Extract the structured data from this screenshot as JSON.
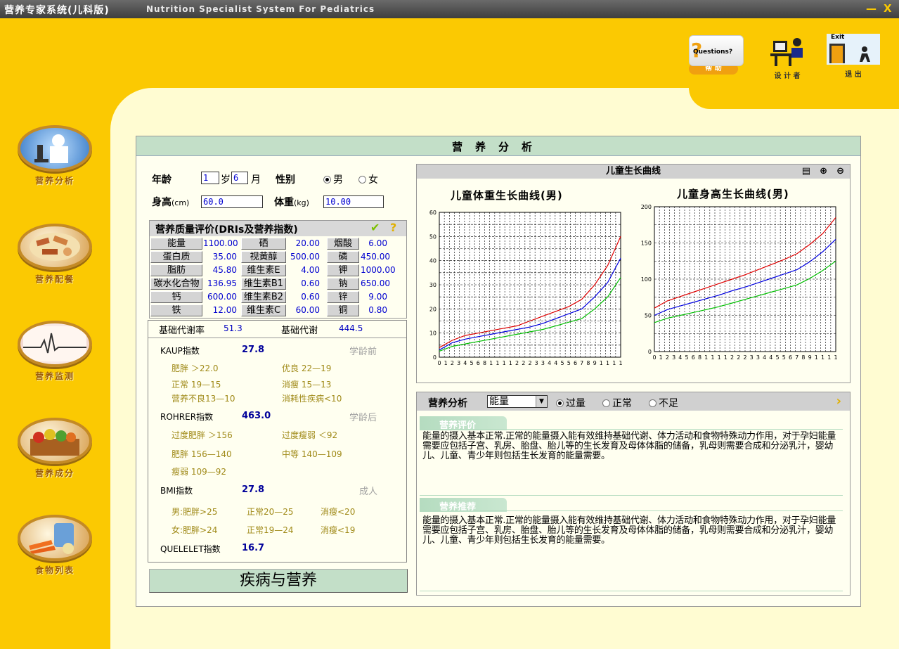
{
  "window": {
    "title": "营养专家系统(儿科版)",
    "subtitle": "Nutrition Specialist System For Pediatrics",
    "minimize": "—",
    "close": "X"
  },
  "toolbar": {
    "help_caption": "Questions?",
    "help_label": "帮 助",
    "designer_label": "设 计 者",
    "exit_caption": "Exit",
    "exit_label": "退 出"
  },
  "sidebar": [
    {
      "label": "营养分析",
      "icon": "doctor-microscope-icon"
    },
    {
      "label": "营养配餐",
      "icon": "meal-plate-icon"
    },
    {
      "label": "营养监测",
      "icon": "ecg-monitor-icon"
    },
    {
      "label": "营养成分",
      "icon": "food-basket-icon"
    },
    {
      "label": "食物列表",
      "icon": "vegetables-icon"
    }
  ],
  "panel": {
    "title": "营养分析"
  },
  "form": {
    "age_label": "年龄",
    "age_years": "1",
    "years_unit": "岁",
    "age_months": "6",
    "months_unit": "月",
    "sex_label": "性别",
    "sex_male": "男",
    "sex_female": "女",
    "height_label": "身高",
    "height_unit": "(cm)",
    "height_value": "60.0",
    "weight_label": "体重",
    "weight_unit": "(kg)",
    "weight_value": "10.00"
  },
  "nutrients": {
    "title": "营养质量评价(DRIs及营养指数)",
    "rows": [
      [
        {
          "name": "能量",
          "value": "1100.00"
        },
        {
          "name": "硒",
          "value": "20.00"
        },
        {
          "name": "烟酸",
          "value": "6.00"
        }
      ],
      [
        {
          "name": "蛋白质",
          "value": "35.00"
        },
        {
          "name": "视黄醇",
          "value": "500.00"
        },
        {
          "name": "磷",
          "value": "450.00"
        }
      ],
      [
        {
          "name": "脂肪",
          "value": "45.80"
        },
        {
          "name": "维生素E",
          "value": "4.00"
        },
        {
          "name": "钾",
          "value": "1000.00"
        }
      ],
      [
        {
          "name": "碳水化合物",
          "value": "136.95"
        },
        {
          "name": "维生素B1",
          "value": "0.60"
        },
        {
          "name": "钠",
          "value": "650.00"
        }
      ],
      [
        {
          "name": "钙",
          "value": "600.00"
        },
        {
          "name": "维生素B2",
          "value": "0.60"
        },
        {
          "name": "锌",
          "value": "9.00"
        }
      ],
      [
        {
          "name": "铁",
          "value": "12.00"
        },
        {
          "name": "维生素C",
          "value": "60.00"
        },
        {
          "name": "铜",
          "value": "0.80"
        }
      ]
    ]
  },
  "metabolism": {
    "bmr_label": "基础代谢率",
    "bmr_value": "51.3",
    "bm_label": "基础代谢",
    "bm_value": "444.5"
  },
  "indices": {
    "kaup_label": "KAUP指数",
    "kaup_value": "27.8",
    "kaup_group": "学龄前",
    "kaup_ranges": [
      "肥胖 ＞22.0",
      "优良 22—19",
      "正常 19—15",
      "消瘦 15—13",
      "营养不良13—10",
      "消耗性疾病<10"
    ],
    "rohrer_label": "ROHRER指数",
    "rohrer_value": "463.0",
    "rohrer_group": "学龄后",
    "rohrer_ranges": [
      "过度肥胖 ＞156",
      "过度瘦弱 ＜92",
      "肥胖 156—140",
      "中等 140—109",
      "瘦弱 109—92"
    ],
    "bmi_label": "BMI指数",
    "bmi_value": "27.8",
    "bmi_group": "成人",
    "bmi_ranges": [
      "男:肥胖>25",
      "正常20—25",
      "消瘦<20",
      "女:肥胖>24",
      "正常19—24",
      "消瘦<19"
    ],
    "quelelet_label": "QUELELET指数",
    "quelelet_value": "16.7"
  },
  "disease_button": "疾病与营养",
  "growth": {
    "header": "儿童生长曲线",
    "weight_title": "儿童体重生长曲线(男)",
    "height_title": "儿童身高生长曲线(男)"
  },
  "analysis": {
    "label": "营养分析",
    "select_value": "能量",
    "opt_over": "过量",
    "opt_normal": "正常",
    "opt_low": "不足",
    "eval_tag": "营养评价",
    "eval_text": "能量的摄入基本正常.正常的能量摄入能有效维持基础代谢、体力活动和食物特殊动力作用，对于孕妇能量需要应包括子宫、乳房、胎盘、胎儿等的生长发育及母体体脂的储备，乳母则需要合成和分泌乳汁，婴幼儿、儿童、青少年则包括生长发育的能量需要。",
    "rec_tag": "营养推荐",
    "rec_text": "能量的摄入基本正常.正常的能量摄入能有效维持基础代谢、体力活动和食物特殊动力作用，对于孕妇能量需要应包括子宫、乳房、胎盘、胎儿等的生长发育及母体体脂的储备，乳母则需要合成和分泌乳汁，婴幼儿、儿童、青少年则包括生长发育的能量需要。"
  },
  "colors": {
    "upper": "#e00000",
    "median": "#0000e0",
    "lower": "#00c000"
  },
  "chart_data": [
    {
      "type": "line",
      "title": "儿童体重生长曲线(男)",
      "ylim": [
        0,
        60
      ],
      "yticks": [
        0,
        10,
        20,
        30,
        40,
        50,
        60
      ],
      "xticks": [
        "0",
        "1",
        "2",
        "3",
        "4",
        "5",
        "6",
        "8",
        "1",
        "1",
        "1",
        "1",
        "2",
        "2",
        "2",
        "3",
        "3",
        "4",
        "4",
        "5",
        "5",
        "6",
        "7",
        "8",
        "9",
        "1",
        "1",
        "1",
        "1"
      ],
      "x": [
        0,
        2,
        4,
        6,
        8,
        10,
        12,
        14,
        16,
        18,
        20,
        22,
        24,
        26,
        28
      ],
      "series": [
        {
          "values": [
            4,
            7,
            9,
            10,
            11,
            12,
            13,
            15,
            17,
            19,
            21,
            24,
            30,
            38,
            50
          ]
        },
        {
          "values": [
            3,
            6,
            7.5,
            8.5,
            9.5,
            10.5,
            11.5,
            12.5,
            14,
            16,
            18,
            20,
            25,
            31,
            41
          ]
        },
        {
          "values": [
            2.5,
            4.5,
            5.5,
            6.5,
            7.5,
            8.5,
            9.5,
            10.5,
            11.5,
            13,
            14.5,
            16,
            20,
            25,
            33
          ]
        }
      ]
    },
    {
      "type": "line",
      "title": "儿童身高生长曲线(男)",
      "ylim": [
        0,
        200
      ],
      "yticks": [
        0,
        50,
        100,
        150,
        200
      ],
      "xticks": [
        "0",
        "1",
        "2",
        "3",
        "4",
        "5",
        "6",
        "8",
        "1",
        "1",
        "1",
        "1",
        "2",
        "2",
        "2",
        "3",
        "3",
        "4",
        "4",
        "5",
        "5",
        "6",
        "7",
        "8",
        "9",
        "1",
        "1",
        "1",
        "1"
      ],
      "x": [
        0,
        2,
        4,
        6,
        8,
        10,
        12,
        14,
        16,
        18,
        20,
        22,
        24,
        26,
        28
      ],
      "series": [
        {
          "values": [
            60,
            70,
            76,
            82,
            88,
            94,
            100,
            106,
            113,
            120,
            127,
            135,
            148,
            163,
            185
          ]
        },
        {
          "values": [
            50,
            58,
            63,
            68,
            73,
            78,
            84,
            89,
            95,
            101,
            107,
            113,
            124,
            138,
            155
          ]
        },
        {
          "values": [
            40,
            46,
            50,
            54,
            58,
            62,
            67,
            72,
            77,
            82,
            87,
            92,
            101,
            112,
            125
          ]
        }
      ]
    }
  ]
}
